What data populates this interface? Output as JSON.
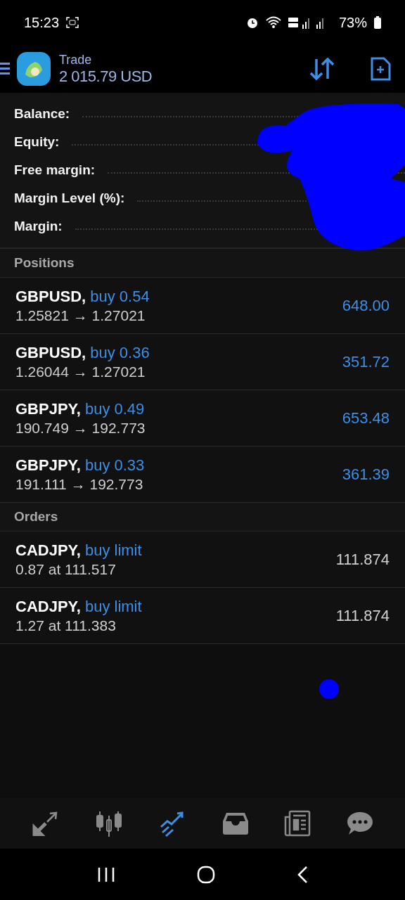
{
  "status_bar": {
    "time": "15:23",
    "battery": "73%"
  },
  "header": {
    "title": "Trade",
    "balance": "2 015.79 USD"
  },
  "summary": [
    {
      "label": "Balance:"
    },
    {
      "label": "Equity:"
    },
    {
      "label": "Free margin:"
    },
    {
      "label": "Margin Level (%):"
    },
    {
      "label": "Margin:"
    }
  ],
  "sections": [
    {
      "title": "Positions",
      "items": [
        {
          "symbol": "GBPUSD,",
          "type": "buy 0.54",
          "detail": "1.25821 → 1.27021",
          "value": "648.00",
          "kind": "position"
        },
        {
          "symbol": "GBPUSD,",
          "type": "buy 0.36",
          "detail": "1.26044 → 1.27021",
          "value": "351.72",
          "kind": "position"
        },
        {
          "symbol": "GBPJPY,",
          "type": "buy 0.49",
          "detail": "190.749 → 192.773",
          "value": "653.48",
          "kind": "position"
        },
        {
          "symbol": "GBPJPY,",
          "type": "buy 0.33",
          "detail": "191.111 → 192.773",
          "value": "361.39",
          "kind": "position"
        }
      ]
    },
    {
      "title": "Orders",
      "items": [
        {
          "symbol": "CADJPY,",
          "type": "buy limit",
          "detail": "0.87 at 111.517",
          "value": "111.874",
          "kind": "order"
        },
        {
          "symbol": "CADJPY,",
          "type": "buy limit",
          "detail": "1.27 at 111.383",
          "value": "111.874",
          "kind": "order"
        }
      ]
    }
  ],
  "bottom_nav": [
    {
      "kind": "quotes",
      "selected": false
    },
    {
      "kind": "chart",
      "selected": false
    },
    {
      "kind": "trade",
      "selected": true
    },
    {
      "kind": "history",
      "selected": false
    },
    {
      "kind": "news",
      "selected": false
    },
    {
      "kind": "chat",
      "selected": false
    }
  ]
}
